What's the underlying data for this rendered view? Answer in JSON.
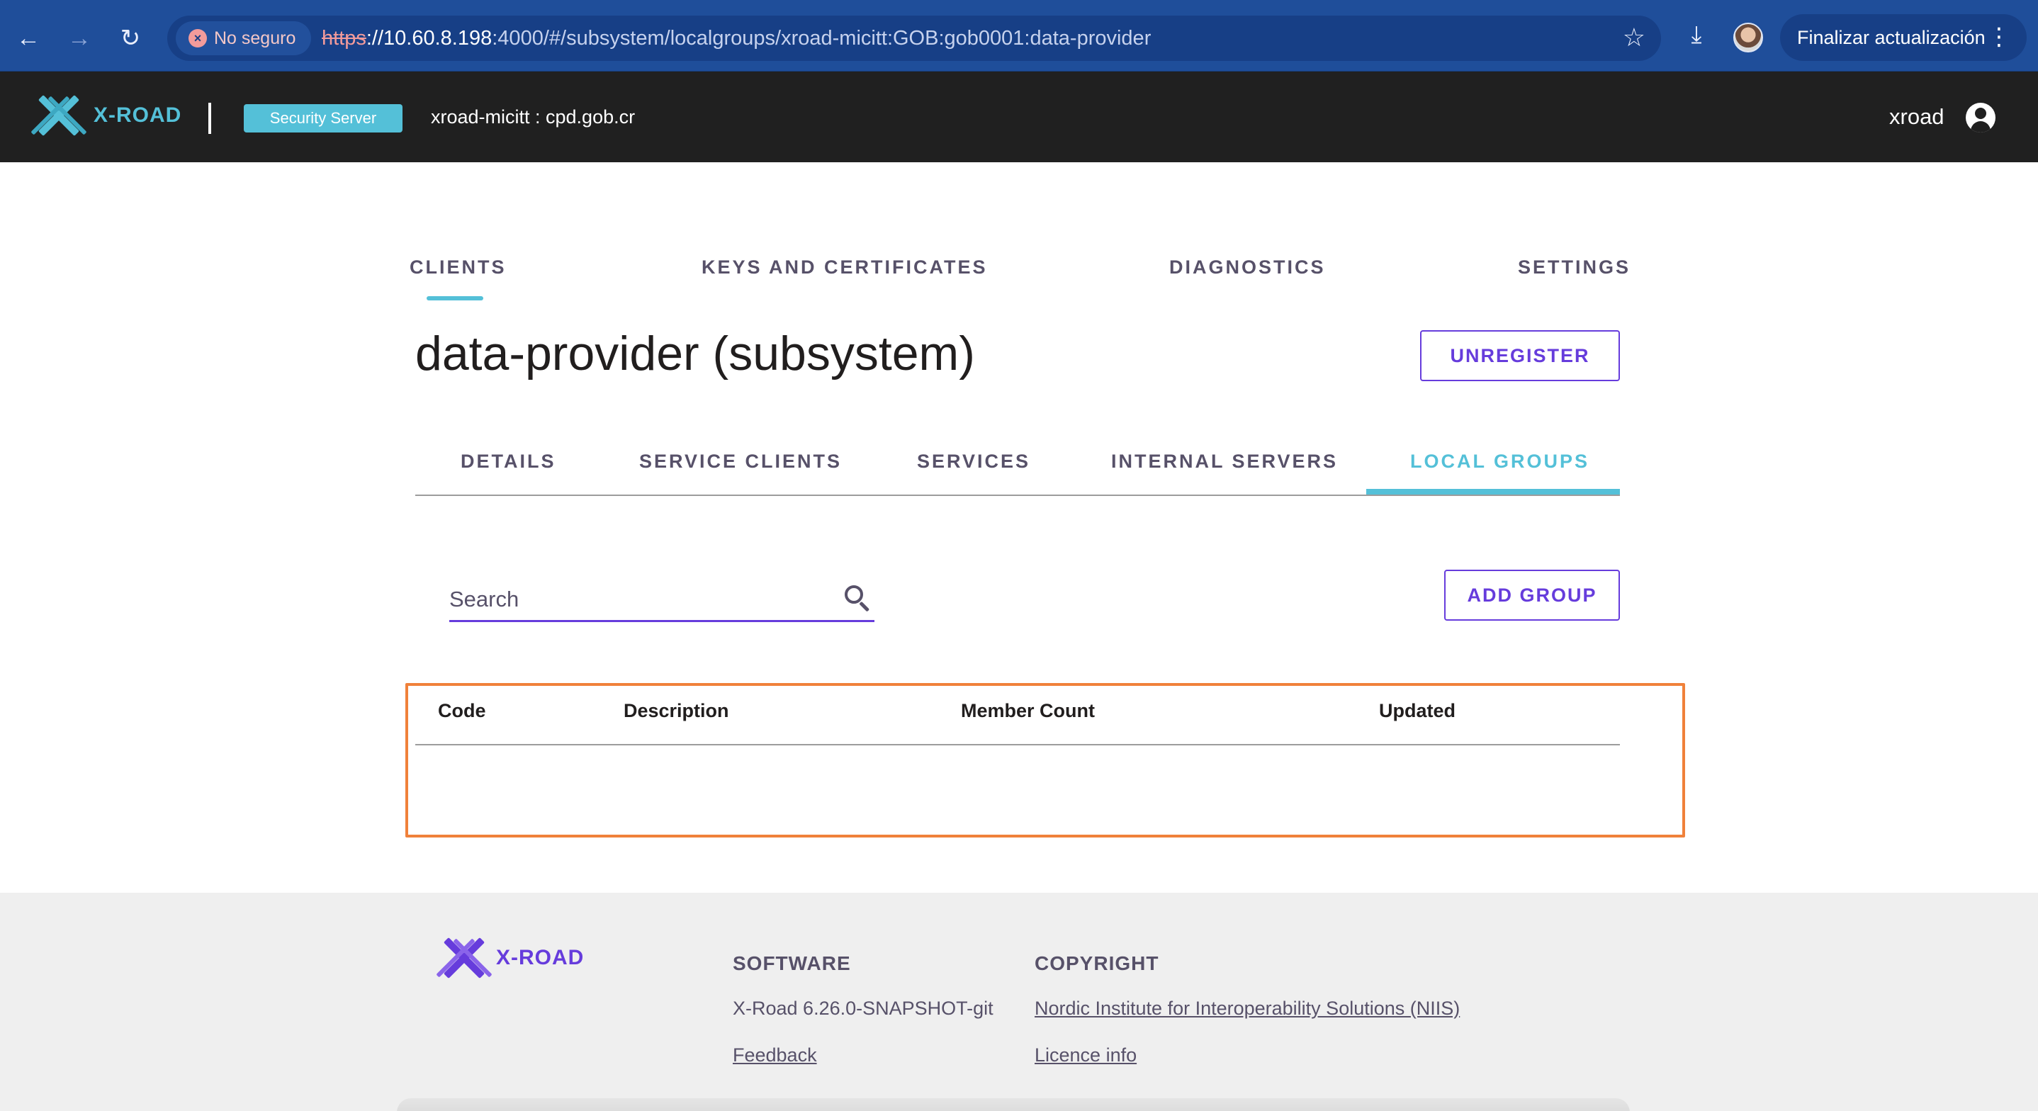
{
  "browser": {
    "security_label": "No seguro",
    "url_proto": "https",
    "url_host": "://10.60.8.198",
    "url_rest": ":4000/#/subsystem/localgroups/xroad-micitt:GOB:gob0001:data-provider",
    "update_label": "Finalizar actualización"
  },
  "header": {
    "logo_text": "X-ROAD",
    "server_badge": "Security Server",
    "server_id": "xroad-micitt : cpd.gob.cr",
    "user": "xroad"
  },
  "main_tabs": [
    "CLIENTS",
    "KEYS AND CERTIFICATES",
    "DIAGNOSTICS",
    "SETTINGS"
  ],
  "page": {
    "title": "data-provider (subsystem)",
    "unregister_label": "UNREGISTER"
  },
  "sub_tabs": [
    "DETAILS",
    "SERVICE CLIENTS",
    "SERVICES",
    "INTERNAL SERVERS",
    "LOCAL GROUPS"
  ],
  "active_sub_tab": "LOCAL GROUPS",
  "search": {
    "placeholder": "Search",
    "value": ""
  },
  "add_group_label": "ADD GROUP",
  "table": {
    "columns": [
      "Code",
      "Description",
      "Member Count",
      "Updated"
    ],
    "rows": []
  },
  "footer": {
    "logo_text": "X-ROAD",
    "software_heading": "SOFTWARE",
    "version": "X-Road 6.26.0-SNAPSHOT-git",
    "feedback": "Feedback",
    "copyright_heading": "COPYRIGHT",
    "niis": "Nordic Institute for Interoperability Solutions (NIIS)",
    "licence": "Licence info"
  },
  "colors": {
    "accent": "#663cdc",
    "brand_teal": "#54c0d8",
    "header_bg": "#202020",
    "highlight": "#f0813a"
  }
}
